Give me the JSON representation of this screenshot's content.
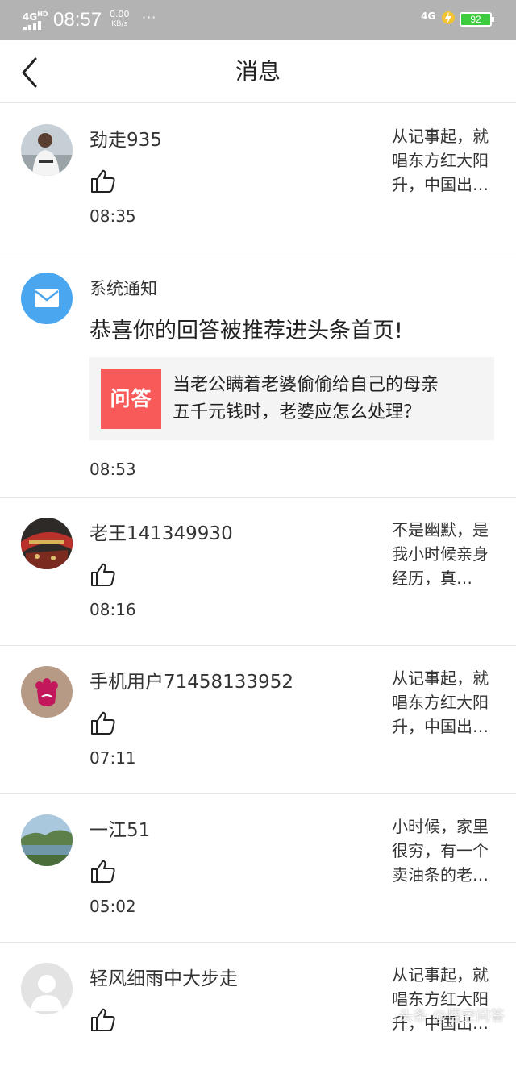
{
  "status_bar": {
    "network": "4G",
    "network_sup": "HD",
    "time": "08:57",
    "speed_value": "0.00",
    "speed_unit": "KB/s",
    "more": "···",
    "right_network": "4G",
    "battery": "92",
    "battery_color": "#3ecb3e"
  },
  "nav": {
    "title": "消息"
  },
  "messages": [
    {
      "user": "劲走935",
      "time": "08:35",
      "preview": [
        "从记事起，就",
        "唱东方红大阳",
        "升，中国出…"
      ]
    },
    {
      "user": "老王141349930",
      "time": "08:16",
      "preview": [
        "不是幽默，是",
        "我小时候亲身",
        "经历，真…"
      ]
    },
    {
      "user": "手机用户71458133952",
      "time": "07:11",
      "preview": [
        "从记事起，就",
        "唱东方红大阳",
        "升，中国出…"
      ]
    },
    {
      "user": "一江51",
      "time": "05:02",
      "preview": [
        "小时候，家里",
        "很穷，有一个",
        "卖油条的老…"
      ]
    },
    {
      "user": "轻风细雨中大步走",
      "time": "",
      "preview": [
        "从记事起，就",
        "唱东方红大阳",
        "升，中国出…"
      ]
    }
  ],
  "system_notice": {
    "name": "系统通知",
    "headline": "恭喜你的回答被推荐进头条首页!",
    "card_logo": "问答",
    "card_lines": [
      "当老公瞒着老婆偷偷给自己的母亲",
      "五千元钱时，老婆应怎么处理？"
    ],
    "time": "08:53",
    "icon_color": "#4aa6ee",
    "logo_color": "#f85959"
  },
  "icons": {
    "back": "chevron-left-icon",
    "like": "thumbs-up-icon",
    "mail": "mail-icon"
  },
  "watermark": "头条 @悟空问答"
}
